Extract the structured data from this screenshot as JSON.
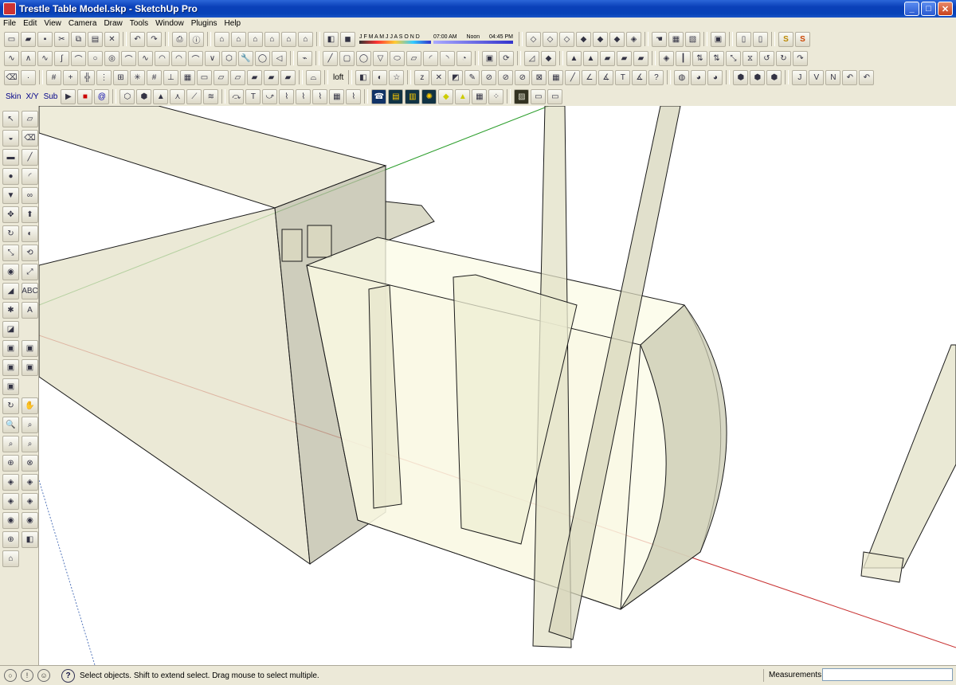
{
  "window": {
    "title": "Trestle Table Model.skp - SketchUp Pro",
    "buttons": {
      "minimize": "_",
      "maximize": "□",
      "close": "✕"
    }
  },
  "menu": [
    "File",
    "Edit",
    "View",
    "Camera",
    "Draw",
    "Tools",
    "Window",
    "Plugins",
    "Help"
  ],
  "toolbar": {
    "shadow_months": "J F M A M J J A S O N D",
    "time_start": "07:00 AM",
    "time_noon": "Noon",
    "time_end": "04:45 PM",
    "loft_label": "loft",
    "skin_label": "Skin",
    "xy_label": "X/Y",
    "sub_label": "Sub"
  },
  "statusbar": {
    "message": "Select objects. Shift to extend select. Drag mouse to select multiple.",
    "measurements_label": "Measurements",
    "measurements_value": ""
  },
  "colors": {
    "titlebar": "#0a3fb8",
    "axis_red": "#cc2222",
    "axis_green": "#22aa22",
    "model_face": "#f5f3d8",
    "model_edge": "#1a1a1a"
  }
}
